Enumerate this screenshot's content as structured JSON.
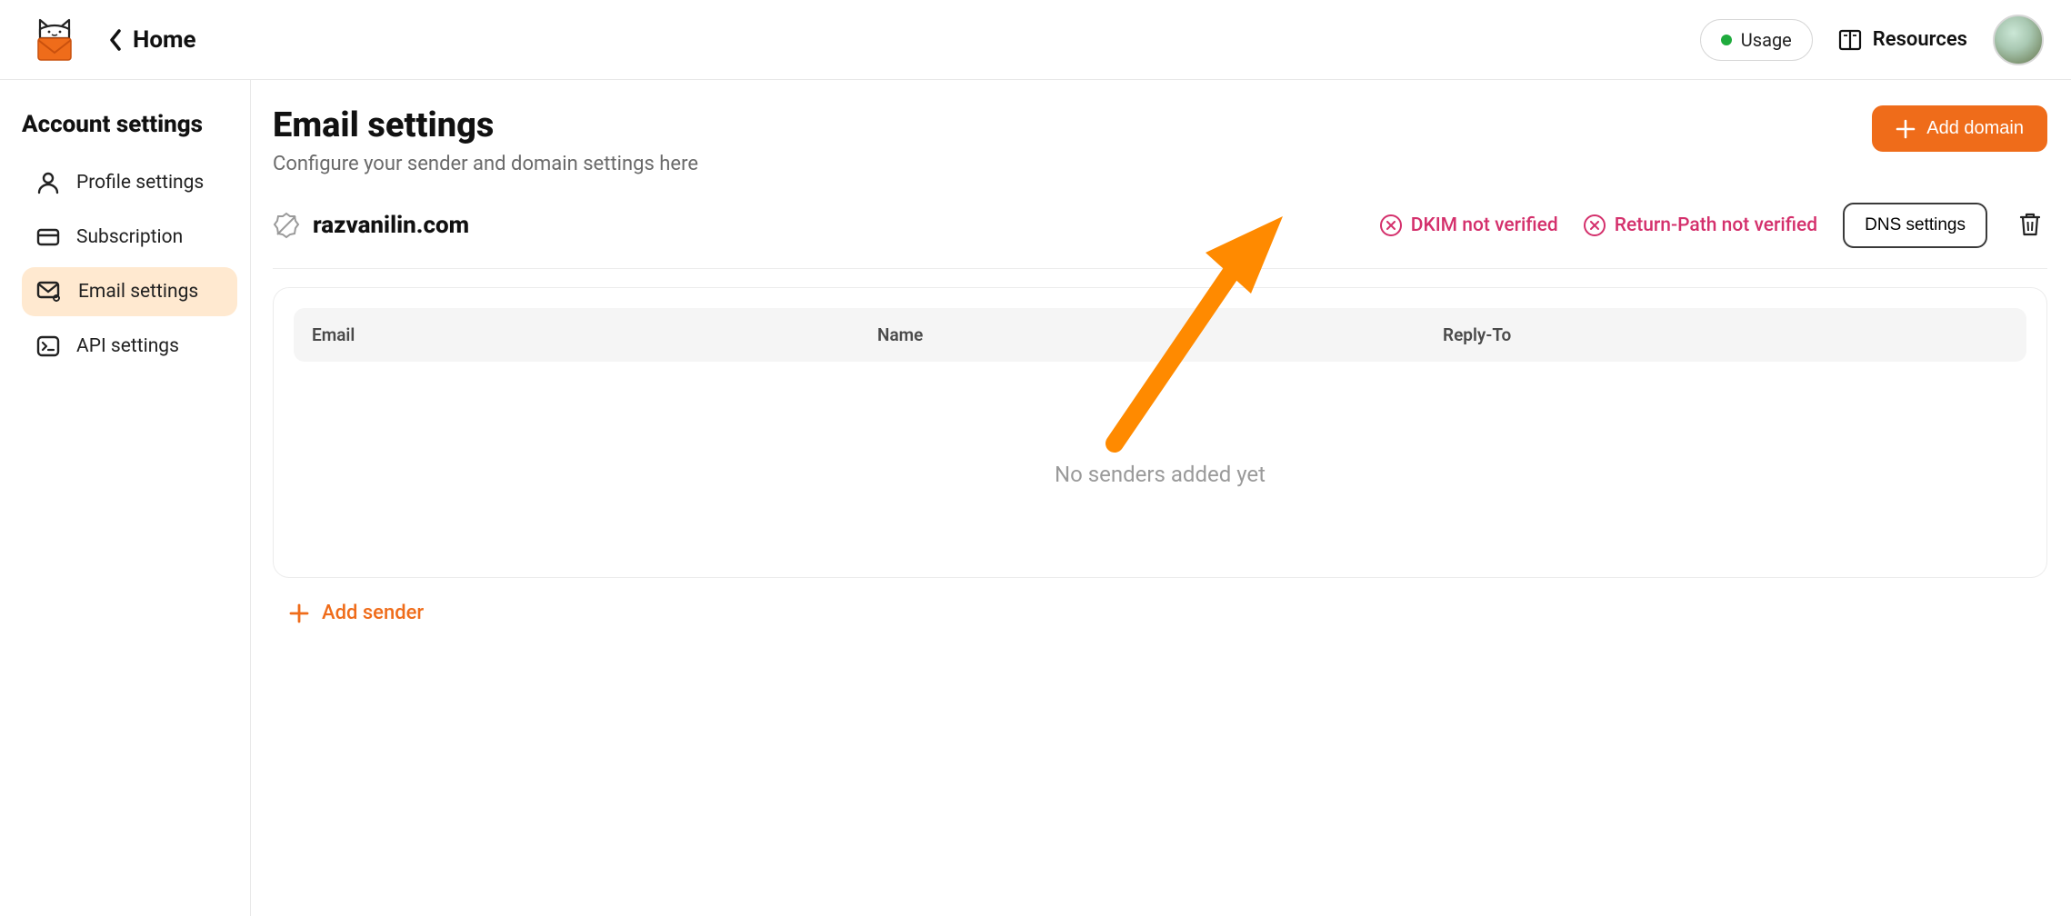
{
  "header": {
    "home_label": "Home",
    "usage_label": "Usage",
    "resources_label": "Resources"
  },
  "sidebar": {
    "title": "Account settings",
    "items": [
      {
        "label": "Profile settings"
      },
      {
        "label": "Subscription"
      },
      {
        "label": "Email settings"
      },
      {
        "label": "API settings"
      }
    ]
  },
  "page": {
    "title": "Email settings",
    "subtitle": "Configure your sender and domain settings here",
    "add_domain_label": "Add domain"
  },
  "domain": {
    "name": "razvanilin.com",
    "dkim_status": "DKIM not verified",
    "return_path_status": "Return-Path not verified",
    "dns_button_label": "DNS settings"
  },
  "senders_table": {
    "columns": [
      "Email",
      "Name",
      "Reply-To"
    ],
    "empty_message": "No senders added yet",
    "add_sender_label": "Add sender"
  },
  "colors": {
    "accent": "#ef6c1a",
    "danger": "#d4306c",
    "success": "#1fab3d"
  }
}
